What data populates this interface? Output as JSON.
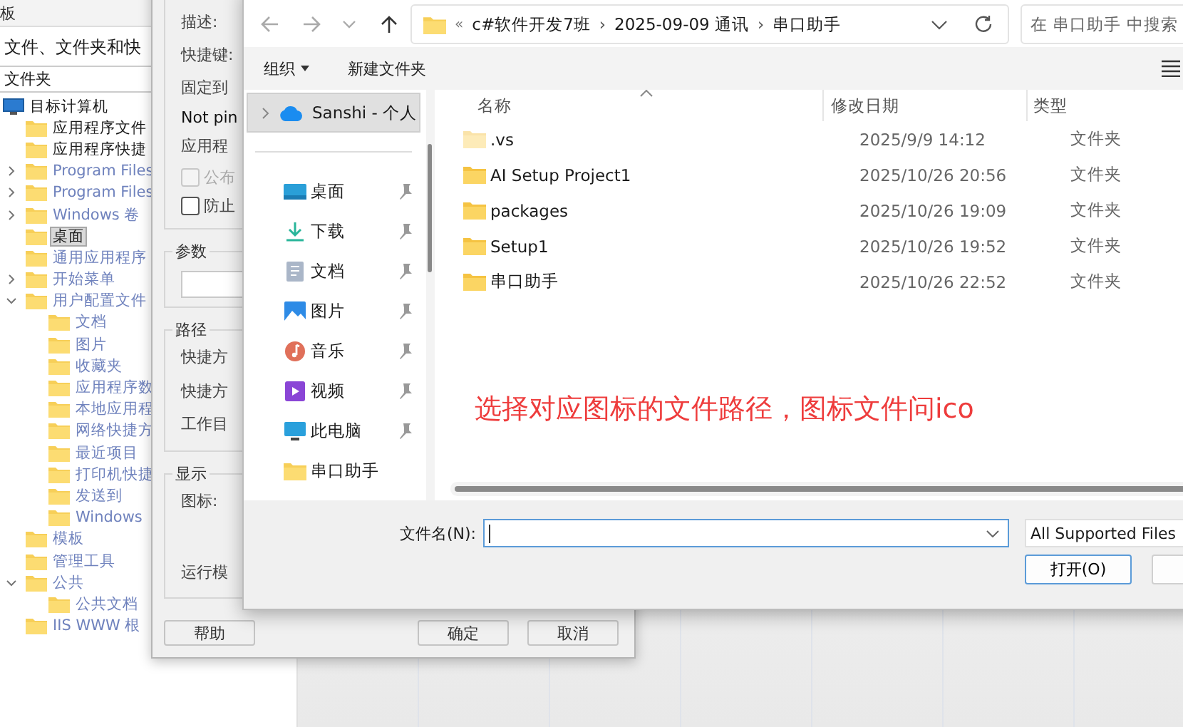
{
  "background_app": {
    "tab": "板",
    "heading": "文件、文件夹和快",
    "tree_header": "文件夹",
    "tree": [
      {
        "label": "目标计算机",
        "kind": "computer",
        "muted": false,
        "selected": false,
        "children": [
          {
            "label": "应用程序文件",
            "muted": false,
            "selected": false
          },
          {
            "label": "应用程序快捷",
            "muted": false,
            "selected": false
          },
          {
            "label": "Program Files",
            "muted": true,
            "selected": false,
            "expanded": false
          },
          {
            "label": "Program Files",
            "muted": true,
            "selected": false,
            "expanded": false
          },
          {
            "label": "Windows 卷",
            "muted": true,
            "selected": false,
            "expanded": false
          },
          {
            "label": "桌面",
            "muted": false,
            "selected": true
          },
          {
            "label": "通用应用程序",
            "muted": true,
            "selected": false
          },
          {
            "label": "开始菜单",
            "muted": true,
            "selected": false,
            "expanded": false
          },
          {
            "label": "用户配置文件",
            "muted": true,
            "selected": false,
            "expanded": true,
            "children": [
              {
                "label": "文档",
                "muted": true,
                "selected": false
              },
              {
                "label": "图片",
                "muted": true,
                "selected": false
              },
              {
                "label": "收藏夹",
                "muted": true,
                "selected": false
              },
              {
                "label": "应用程序数",
                "muted": true,
                "selected": false
              },
              {
                "label": "本地应用程",
                "muted": true,
                "selected": false
              },
              {
                "label": "网络快捷方",
                "muted": true,
                "selected": false
              },
              {
                "label": "最近项目",
                "muted": true,
                "selected": false
              },
              {
                "label": "打印机快捷",
                "muted": true,
                "selected": false
              },
              {
                "label": "发送到",
                "muted": true,
                "selected": false
              },
              {
                "label": "Windows",
                "muted": true,
                "selected": false
              }
            ]
          },
          {
            "label": "模板",
            "muted": true,
            "selected": false
          },
          {
            "label": "管理工具",
            "muted": true,
            "selected": false
          },
          {
            "label": "公共",
            "muted": true,
            "selected": false,
            "expanded": true,
            "children": [
              {
                "label": "公共文档",
                "muted": true,
                "selected": false
              }
            ]
          },
          {
            "label": "IIS WWW 根",
            "muted": true,
            "selected": false
          }
        ]
      }
    ]
  },
  "properties_dialog": {
    "general": [
      {
        "kind": "label",
        "text": "描述:"
      },
      {
        "kind": "label",
        "text": "快捷键:"
      },
      {
        "kind": "label",
        "text": "固定到"
      },
      {
        "kind": "value",
        "text": "Not pin"
      },
      {
        "kind": "label",
        "text": "应用程"
      },
      {
        "kind": "checkbox",
        "text": "公布",
        "checked": false,
        "disabled": true
      },
      {
        "kind": "checkbox",
        "text": "防止",
        "checked": false,
        "disabled": false
      }
    ],
    "groups": [
      {
        "title": "参数",
        "rows": [
          {
            "kind": "field"
          }
        ]
      },
      {
        "title": "路径",
        "rows": [
          {
            "kind": "label",
            "text": "快捷方"
          },
          {
            "kind": "label",
            "text": "快捷方"
          },
          {
            "kind": "label",
            "text": "工作目"
          }
        ]
      },
      {
        "title": "显示",
        "rows": [
          {
            "kind": "label",
            "text": "图标:"
          },
          {
            "kind": "label",
            "text": "运行模"
          }
        ]
      }
    ],
    "buttons": [
      "帮助",
      "确定",
      "取消"
    ]
  },
  "file_dialog": {
    "breadcrumb": {
      "overflow": "«",
      "parts": [
        "c#软件开发7班",
        "2025-09-09 通讯",
        "串口助手"
      ],
      "separator": "›"
    },
    "search": {
      "placeholder": "在 串口助手 中搜索"
    },
    "toolbar": {
      "organize": "组织",
      "new_folder": "新建文件夹"
    },
    "nav": {
      "account": {
        "label": "Sanshi - 个人",
        "selected": true
      },
      "items": [
        {
          "label": "桌面",
          "kind": "desktop",
          "pinned": true
        },
        {
          "label": "下载",
          "kind": "download",
          "pinned": true
        },
        {
          "label": "文档",
          "kind": "documents",
          "pinned": true
        },
        {
          "label": "图片",
          "kind": "pictures",
          "pinned": true
        },
        {
          "label": "音乐",
          "kind": "music",
          "pinned": true
        },
        {
          "label": "视频",
          "kind": "videos",
          "pinned": true
        },
        {
          "label": "此电脑",
          "kind": "pc",
          "pinned": true
        },
        {
          "label": "串口助手",
          "kind": "folder",
          "pinned": false
        }
      ]
    },
    "columns": [
      "名称",
      "修改日期",
      "类型"
    ],
    "files": [
      {
        "name": ".vs",
        "modified": "2025/9/9 14:12",
        "type": "文件夹",
        "hidden": true
      },
      {
        "name": "AI Setup Project1",
        "modified": "2025/10/26 20:56",
        "type": "文件夹",
        "hidden": false
      },
      {
        "name": "packages",
        "modified": "2025/10/26 19:09",
        "type": "文件夹",
        "hidden": false
      },
      {
        "name": "Setup1",
        "modified": "2025/10/26 19:52",
        "type": "文件夹",
        "hidden": false
      },
      {
        "name": "串口助手",
        "modified": "2025/10/26 22:52",
        "type": "文件夹",
        "hidden": false
      }
    ],
    "annotation": "选择对应图标的文件路径，图标文件问ico",
    "filename_label": "文件名(N):",
    "filetype": "All Supported Files",
    "open_button": "打开(O)"
  }
}
